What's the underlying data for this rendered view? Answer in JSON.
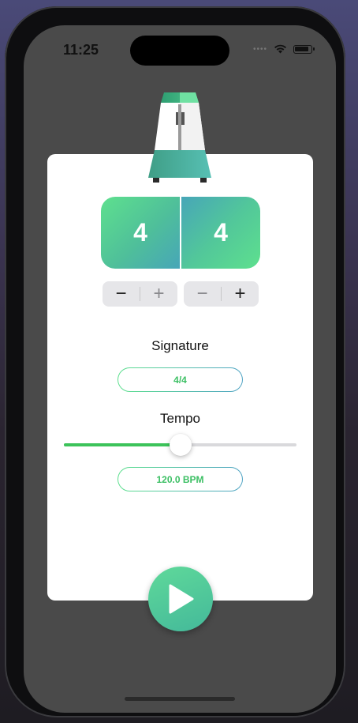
{
  "status_bar": {
    "time": "11:25",
    "icons": [
      "signal-dots-icon",
      "wifi-icon",
      "battery-icon"
    ]
  },
  "colors": {
    "accent": "#3cc35a",
    "gradient_start": "#5ee08e",
    "gradient_end": "#47a6b8",
    "screen_bg": "#4a4a4a"
  },
  "signature": {
    "beats": "4",
    "note_value": "4",
    "label": "Signature",
    "display": "4/4",
    "beats_stepper": {
      "minus": "−",
      "plus": "+"
    },
    "note_stepper": {
      "minus": "−",
      "plus": "+"
    }
  },
  "tempo": {
    "label": "Tempo",
    "display": "120.0 BPM",
    "slider_fraction": 0.5
  },
  "play_button": {
    "icon": "play-icon"
  }
}
